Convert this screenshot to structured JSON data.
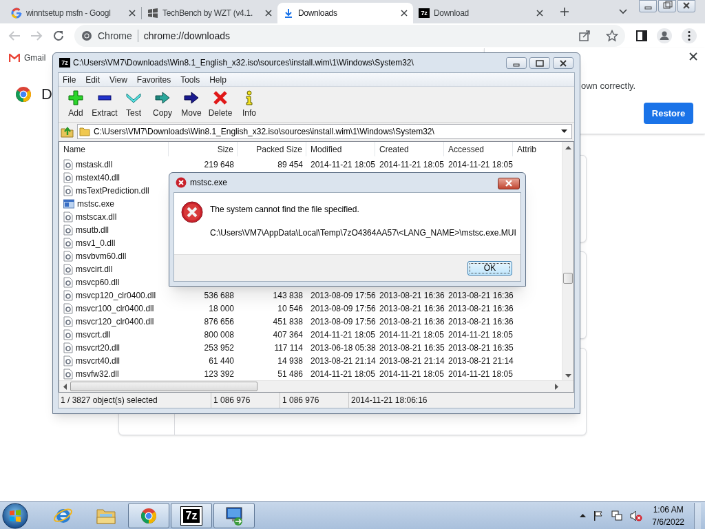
{
  "browser": {
    "tabs": [
      {
        "title": "winntsetup msfn - Googl",
        "kind": "google",
        "selected": false
      },
      {
        "title": "TechBench by WZT (v4.1.",
        "kind": "windows",
        "selected": false
      },
      {
        "title": "Downloads",
        "kind": "download",
        "selected": true
      },
      {
        "title": "Download",
        "kind": "archiver",
        "icon_text": "7z",
        "selected": false
      }
    ],
    "omnibox": {
      "chip": "Chrome",
      "url": "chrome://downloads"
    },
    "bookmarks": [
      {
        "label": "Gmail"
      }
    ],
    "page": {
      "heading": "D",
      "notice": {
        "text": "own correctly.",
        "button": "Restore"
      }
    }
  },
  "archive_window": {
    "icon_text": "7z",
    "title": "C:\\Users\\VM7\\Downloads\\Win8.1_English_x32.iso\\sources\\install.wim\\1\\Windows\\System32\\",
    "menu": [
      "File",
      "Edit",
      "View",
      "Favorites",
      "Tools",
      "Help"
    ],
    "toolbar": [
      {
        "label": "Add",
        "kind": "add"
      },
      {
        "label": "Extract",
        "kind": "extract"
      },
      {
        "label": "Test",
        "kind": "test"
      },
      {
        "label": "Copy",
        "kind": "copy"
      },
      {
        "label": "Move",
        "kind": "move"
      },
      {
        "label": "Delete",
        "kind": "delete"
      },
      {
        "label": "Info",
        "kind": "info"
      }
    ],
    "path": "C:\\Users\\VM7\\Downloads\\Win8.1_English_x32.iso\\sources\\install.wim\\1\\Windows\\System32\\",
    "columns": [
      "Name",
      "Size",
      "Packed Size",
      "Modified",
      "Created",
      "Accessed",
      "Attrib"
    ],
    "rows": [
      {
        "name": "mstask.dll",
        "kind": "dll",
        "cells": [
          "219 648",
          "89 454",
          "2014-11-21 18:05",
          "2014-11-21 18:05",
          "2014-11-21 18:05"
        ]
      },
      {
        "name": "mstext40.dll",
        "kind": "dll"
      },
      {
        "name": "msTextPrediction.dll",
        "kind": "dll"
      },
      {
        "name": "mstsc.exe",
        "kind": "exe"
      },
      {
        "name": "mstscax.dll",
        "kind": "dll"
      },
      {
        "name": "msutb.dll",
        "kind": "dll"
      },
      {
        "name": "msv1_0.dll",
        "kind": "dll"
      },
      {
        "name": "msvbvm60.dll",
        "kind": "dll"
      },
      {
        "name": "msvcirt.dll",
        "kind": "dll"
      },
      {
        "name": "msvcp60.dll",
        "kind": "dll"
      },
      {
        "name": "msvcp120_clr0400.dll",
        "kind": "dll",
        "cells": [
          "536 688",
          "143 838",
          "2013-08-09 17:56",
          "2013-08-21 16:36",
          "2013-08-21 16:36"
        ]
      },
      {
        "name": "msvcr100_clr0400.dll",
        "kind": "dll",
        "cells": [
          "18 000",
          "10 546",
          "2013-08-09 17:56",
          "2013-08-21 16:36",
          "2013-08-21 16:36"
        ]
      },
      {
        "name": "msvcr120_clr0400.dll",
        "kind": "dll",
        "cells": [
          "876 656",
          "451 838",
          "2013-08-09 17:56",
          "2013-08-21 16:36",
          "2013-08-21 16:36"
        ]
      },
      {
        "name": "msvcrt.dll",
        "kind": "dll",
        "cells": [
          "800 008",
          "407 364",
          "2014-11-21 18:05",
          "2014-11-21 18:05",
          "2014-11-21 18:05"
        ]
      },
      {
        "name": "msvcrt20.dll",
        "kind": "dll",
        "cells": [
          "253 952",
          "117 114",
          "2013-06-18 05:38",
          "2013-08-21 16:35",
          "2013-08-21 16:35"
        ]
      },
      {
        "name": "msvcrt40.dll",
        "kind": "dll",
        "cells": [
          "61 440",
          "14 938",
          "2013-08-21 21:14",
          "2013-08-21 21:14",
          "2013-08-21 21:14"
        ]
      },
      {
        "name": "msvfw32.dll",
        "kind": "dll",
        "cells": [
          "123 392",
          "51 486",
          "2014-11-21 18:05",
          "2014-11-21 18:05",
          "2014-11-21 18:05"
        ]
      }
    ],
    "status": [
      "1 / 3827 object(s) selected",
      "1 086 976",
      "1 086 976",
      "2014-11-21 18:06:16"
    ]
  },
  "dialog": {
    "title": "mstsc.exe",
    "message": "The system cannot find the file specified.",
    "path": "C:\\Users\\VM7\\AppData\\Local\\Temp\\7zO4364AA57\\<LANG_NAME>\\mstsc.exe.MUI",
    "button": "OK"
  },
  "taskbar": {
    "items": [
      {
        "kind": "ie",
        "running": false
      },
      {
        "kind": "explorer",
        "running": false
      },
      {
        "kind": "chrome",
        "running": true
      },
      {
        "kind": "archiver",
        "icon_text": "7z",
        "running": true
      },
      {
        "kind": "rdp",
        "running": true
      }
    ],
    "clock": {
      "time": "1:06 AM",
      "date": "7/6/2022"
    }
  }
}
